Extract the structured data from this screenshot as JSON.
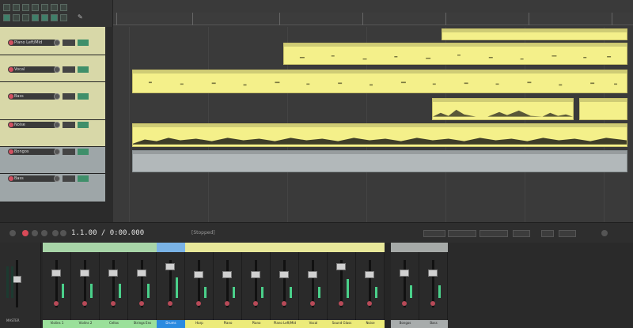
{
  "transport": {
    "time": "1.1.00 / 0:00.000",
    "status": "[Stopped]"
  },
  "tracks": [
    {
      "name": "Piano Left/Mid",
      "color": "yellow"
    },
    {
      "name": "Vocal",
      "color": "yellow"
    },
    {
      "name": "Bass",
      "color": "yellow"
    },
    {
      "name": "Noise",
      "color": "yellow"
    },
    {
      "name": "Bongos",
      "color": "grey"
    },
    {
      "name": "Bass",
      "color": "grey"
    }
  ],
  "mixer": {
    "master_label": "MASTER",
    "strips": [
      {
        "name": "Violins 1",
        "color": "green"
      },
      {
        "name": "Violins 2",
        "color": "green"
      },
      {
        "name": "Cellos",
        "color": "green"
      },
      {
        "name": "Strings Ens",
        "color": "green"
      },
      {
        "name": "Drums",
        "color": "blue"
      },
      {
        "name": "Harp",
        "color": "yellow"
      },
      {
        "name": "Piano",
        "color": "yellow"
      },
      {
        "name": "Piano",
        "color": "yellow"
      },
      {
        "name": "Piano Left/Mid",
        "color": "yellow"
      },
      {
        "name": "Vocal",
        "color": "yellow"
      },
      {
        "name": "Sound Glass",
        "color": "yellow"
      },
      {
        "name": "Noise",
        "color": "yellow"
      },
      {
        "name": "Bongos",
        "color": "grey"
      },
      {
        "name": "Bass",
        "color": "grey"
      }
    ]
  },
  "colors": {
    "clip_yellow": "#f4f08a",
    "clip_grey": "#b2b8ba",
    "track_yellow": "#d8d8a8",
    "track_grey": "#9ea6a8"
  }
}
